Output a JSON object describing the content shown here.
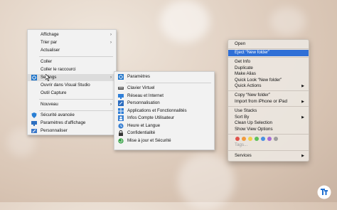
{
  "windows_context_menu": {
    "items": [
      {
        "label": "Affichage",
        "submenu": true
      },
      {
        "label": "Trier par",
        "submenu": true
      },
      {
        "label": "Actualiser"
      },
      {
        "label": "Coller"
      },
      {
        "label": "Coller le raccourci"
      },
      {
        "label": "Settings",
        "submenu": true,
        "highlighted": true,
        "icon": "settings-gear-icon"
      },
      {
        "label": "Ouvrir dans Visual Studio"
      },
      {
        "label": "Outil Capture"
      },
      {
        "label": "Nouveau",
        "submenu": true
      },
      {
        "label": "Sécurité avancée",
        "icon": "shield-icon"
      },
      {
        "label": "Paramètres d'affichage",
        "icon": "display-icon"
      },
      {
        "label": "Personnaliser",
        "icon": "personalize-icon"
      }
    ]
  },
  "settings_submenu": {
    "header": {
      "label": "Paramètres",
      "icon": "settings-gear-icon"
    },
    "items": [
      {
        "label": "Clavier Virtuel",
        "icon": "keyboard-icon"
      },
      {
        "label": "Réseau et Internet",
        "icon": "network-icon"
      },
      {
        "label": "Personnalisation",
        "icon": "paint-icon"
      },
      {
        "label": "Applications et Fonctionnalités",
        "icon": "apps-icon"
      },
      {
        "label": "Infos Compte Utilisateur",
        "icon": "user-icon"
      },
      {
        "label": "Heure et Langue",
        "icon": "clock-icon"
      },
      {
        "label": "Confidentialité",
        "icon": "lock-icon"
      },
      {
        "label": "Mise à jour et Sécurité",
        "icon": "update-icon"
      }
    ]
  },
  "mac_context_menu": {
    "items": [
      {
        "label": "Open"
      },
      {
        "label": "Eject “New folder”",
        "highlighted": true
      },
      {
        "label": "Get Info"
      },
      {
        "label": "Duplicate"
      },
      {
        "label": "Make Alias"
      },
      {
        "label": "Quick Look “New folder”"
      },
      {
        "label": "Quick Actions",
        "submenu": true
      },
      {
        "label": "Copy “New folder”"
      },
      {
        "label": "Import from iPhone or iPad",
        "submenu": true
      },
      {
        "label": "Use Stacks"
      },
      {
        "label": "Sort By",
        "submenu": true
      },
      {
        "label": "Clean Up Selection"
      },
      {
        "label": "Show View Options"
      },
      {
        "label": "Tags..."
      },
      {
        "label": "Services",
        "submenu": true
      }
    ],
    "tag_colors": [
      "#e0524b",
      "#f29b3c",
      "#f2d04b",
      "#5fc15a",
      "#4a90e2",
      "#a66cd6",
      "#9e9e9e"
    ]
  },
  "arrow_glyph": "›"
}
